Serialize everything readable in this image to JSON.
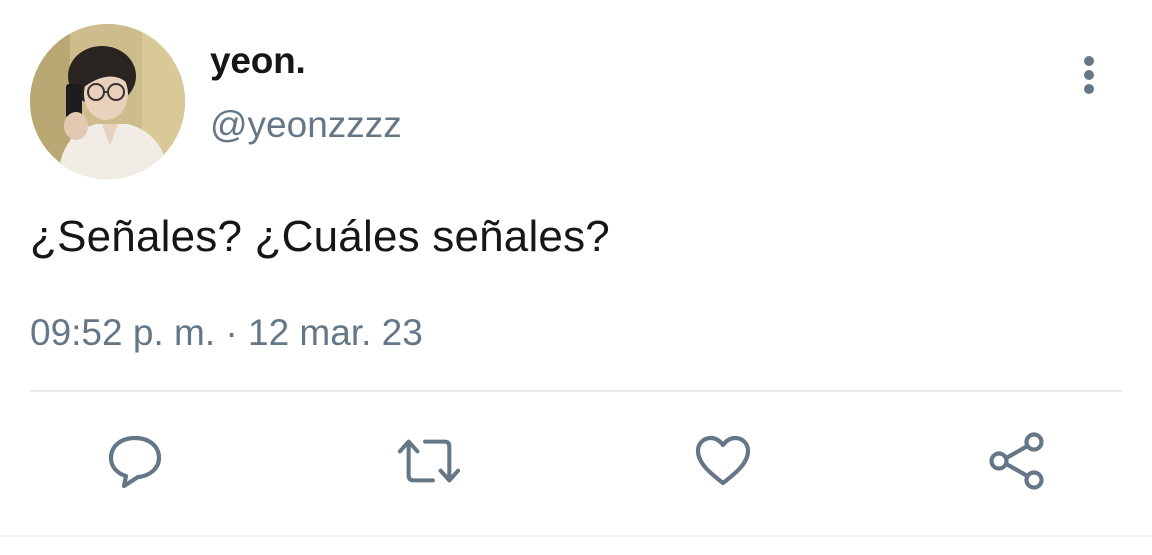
{
  "tweet": {
    "display_name": "yeon.",
    "handle": "@yeonzzzz",
    "text": "¿Señales? ¿Cuáles señales?",
    "time": "09:52 p. m.",
    "separator": "·",
    "date": "12 mar. 23"
  },
  "icons": {
    "more": "more-vertical-icon",
    "reply": "reply-bubble-icon",
    "retweet": "retweet-icon",
    "like": "heart-icon",
    "share": "share-icon"
  },
  "colors": {
    "text_primary": "#14171a",
    "text_secondary": "#657786",
    "divider": "#e6ecf0"
  }
}
